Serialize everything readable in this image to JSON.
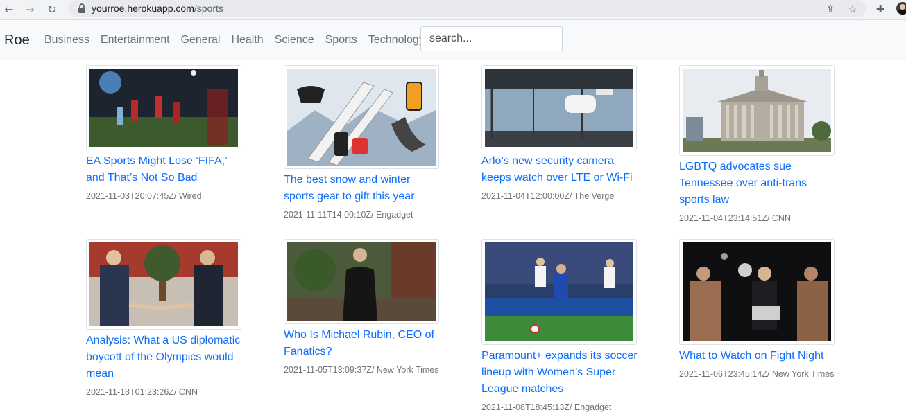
{
  "browser": {
    "url_host": "yourroe.herokuapp.com",
    "url_path": "/sports"
  },
  "navbar": {
    "brand": "Roe",
    "links": [
      "Business",
      "Entertainment",
      "General",
      "Health",
      "Science",
      "Sports",
      "Technology"
    ],
    "search_placeholder": "search..."
  },
  "articles": [
    {
      "title": "EA Sports Might Lose ‘FIFA,’ and That’s Not So Bad",
      "meta": "2021-11-03T20:07:45Z/ Wired",
      "image": "soccer-game-render"
    },
    {
      "title": "The best snow and winter sports gear to gift this year",
      "meta": "2021-11-11T14:00:10Z/ Engadget",
      "image": "ski-gear"
    },
    {
      "title": "Arlo’s new security camera keeps watch over LTE or Wi-Fi",
      "meta": "2021-11-04T12:00:00Z/ The Verge",
      "image": "security-camera"
    },
    {
      "title": "LGBTQ advocates sue Tennessee over anti-trans sports law",
      "meta": "2021-11-04T23:14:51Z/ CNN",
      "image": "capitol-building"
    },
    {
      "title": "Analysis: What a US diplomatic boycott of the Olympics would mean",
      "meta": "2021-11-18T01:23:26Z/ CNN",
      "image": "diplomats-handshake"
    },
    {
      "title": "Who Is Michael Rubin, CEO of Fanatics?",
      "meta": "2021-11-05T13:09:37Z/ New York Times",
      "image": "man-portrait"
    },
    {
      "title": "Paramount+ expands its soccer lineup with Women’s Super League matches",
      "meta": "2021-11-08T18:45:13Z/ Engadget",
      "image": "womens-soccer"
    },
    {
      "title": "What to Watch on Fight Night",
      "meta": "2021-11-06T23:45:14Z/ New York Times",
      "image": "boxing-faceoff"
    }
  ]
}
